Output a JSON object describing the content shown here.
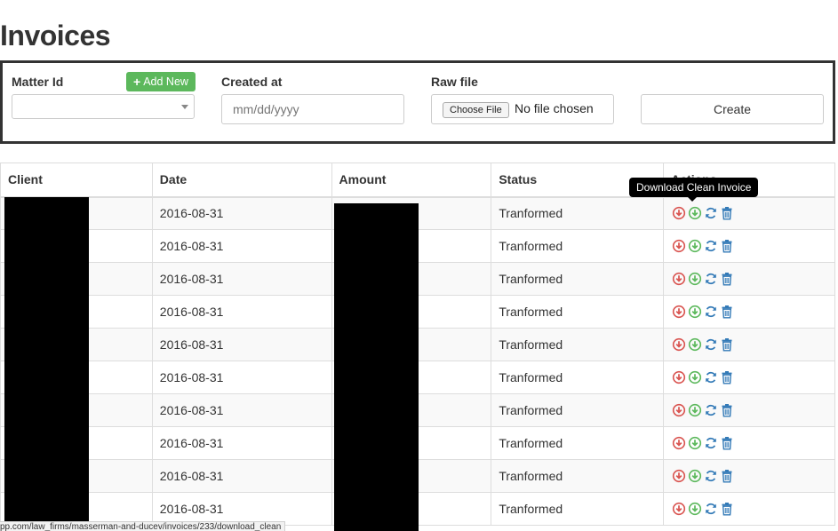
{
  "page": {
    "title": "Invoices"
  },
  "form": {
    "matter_id_label": "Matter Id",
    "add_new_label": "Add New",
    "matter_id_value": "",
    "created_at_label": "Created at",
    "created_at_placeholder": "mm/dd/yyyy",
    "raw_file_label": "Raw file",
    "choose_file_label": "Choose File",
    "no_file_text": "No file chosen",
    "create_label": "Create"
  },
  "table": {
    "columns": [
      "Client",
      "Date",
      "Amount",
      "Status",
      "Actions"
    ],
    "rows": [
      {
        "client": "",
        "date": "2016-08-31",
        "amount": "",
        "status": "Tranformed"
      },
      {
        "client": "",
        "date": "2016-08-31",
        "amount": "",
        "status": "Tranformed"
      },
      {
        "client": "",
        "date": "2016-08-31",
        "amount": "",
        "status": "Tranformed"
      },
      {
        "client": "",
        "date": "2016-08-31",
        "amount": "",
        "status": "Tranformed"
      },
      {
        "client": "",
        "date": "2016-08-31",
        "amount": "",
        "status": "Tranformed"
      },
      {
        "client": "",
        "date": "2016-08-31",
        "amount": "",
        "status": "Tranformed"
      },
      {
        "client": "",
        "date": "2016-08-31",
        "amount": "",
        "status": "Tranformed"
      },
      {
        "client": "",
        "date": "2016-08-31",
        "amount": "",
        "status": "Tranformed"
      },
      {
        "client": "",
        "date": "2016-08-31",
        "amount": "",
        "status": "Tranformed"
      },
      {
        "client": "",
        "date": "2016-08-31",
        "amount": "",
        "status": "Tranformed"
      }
    ],
    "row_actions": [
      {
        "icon": "download-raw-icon",
        "color": "#d9534f"
      },
      {
        "icon": "download-clean-icon",
        "color": "#5cb85c"
      },
      {
        "icon": "refresh-icon",
        "color": "#337ab7"
      },
      {
        "icon": "trash-icon",
        "color": "#337ab7"
      }
    ]
  },
  "tooltip": {
    "text": "Download Clean Invoice"
  },
  "statusbar": {
    "url": "pp.com/law_firms/masserman-and-ducev/invoices/233/download_clean"
  },
  "colors": {
    "accent_green": "#5cb85c",
    "danger_red": "#d9534f",
    "primary_blue": "#337ab7",
    "text": "#333333"
  }
}
